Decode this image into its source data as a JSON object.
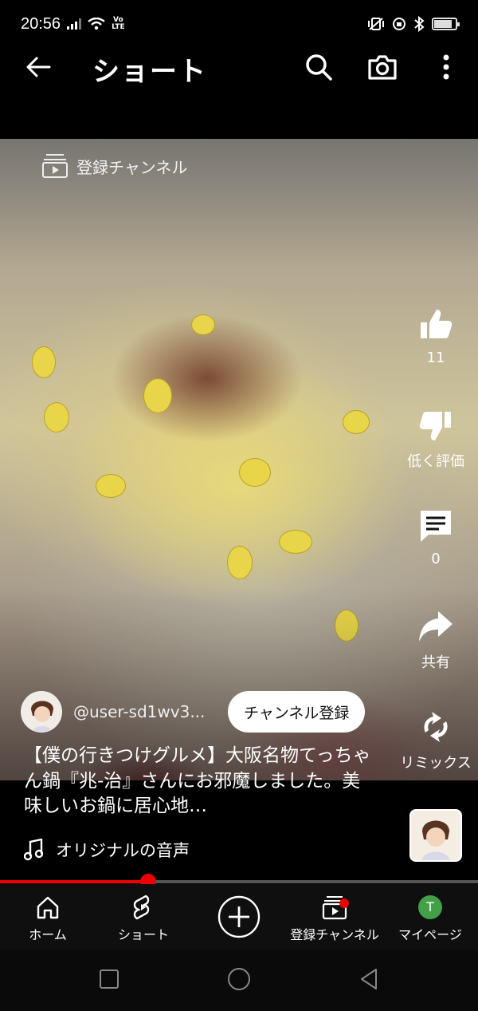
{
  "status": {
    "time": "20:56",
    "volte_top": "Vo",
    "volte_bottom": "LTE",
    "battery_level": 0.85
  },
  "topbar": {
    "title": "ショート",
    "back_icon": "arrow-left-icon",
    "search_icon": "search-icon",
    "camera_icon": "camera-icon",
    "menu_icon": "more-vertical-icon"
  },
  "video": {
    "subscriptions_link": "登録チャンネル"
  },
  "actions": {
    "like_count": "11",
    "dislike_label": "低く評価",
    "comment_count": "0",
    "share_label": "共有",
    "remix_label": "リミックス"
  },
  "channel": {
    "handle": "@user-sd1wv3...",
    "subscribe_label": "チャンネル登録"
  },
  "description": "【僕の行きつけグルメ】大阪名物てっちゃん鍋『兆-治』さんにお邪魔しました。美味しいお鍋に居心地…",
  "audio": {
    "label": "オリジナルの音声"
  },
  "progress": {
    "fraction": 0.31
  },
  "nav": {
    "items": [
      {
        "label": "ホーム",
        "icon": "home-icon"
      },
      {
        "label": "ショート",
        "icon": "shorts-icon"
      },
      {
        "label": "",
        "icon": "create-plus-icon"
      },
      {
        "label": "登録チャンネル",
        "icon": "subscriptions-icon"
      },
      {
        "label": "マイページ",
        "icon": "avatar-icon",
        "avatar_letter": "T"
      }
    ]
  },
  "colors": {
    "accent": "#ff0000",
    "background": "#000000",
    "avatar_green": "#43a047"
  }
}
